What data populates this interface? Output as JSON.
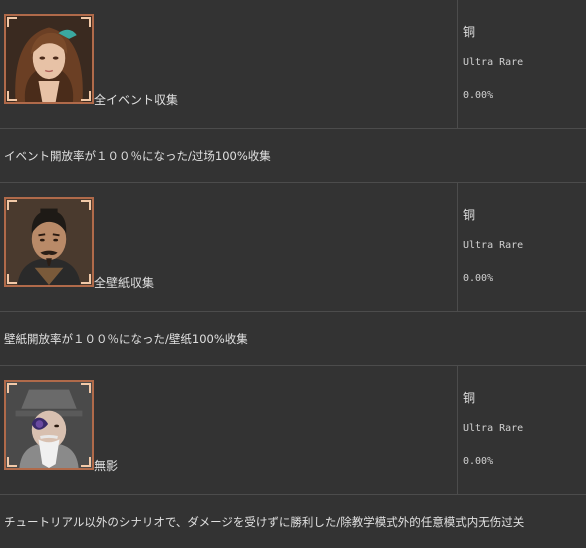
{
  "trophies": [
    {
      "name": "全イベント収集",
      "grade": "铜",
      "rarity": "Ultra Rare",
      "percent": "0.00%",
      "description": "イベント開放率が１００％になった/过场100%收集",
      "icon": "woman-portrait-icon"
    },
    {
      "name": "全壁紙収集",
      "grade": "铜",
      "rarity": "Ultra Rare",
      "percent": "0.00%",
      "description": "壁紙開放率が１００％になった/壁纸100%收集",
      "icon": "man-portrait-icon"
    },
    {
      "name": "無影",
      "grade": "铜",
      "rarity": "Ultra Rare",
      "percent": "0.00%",
      "description": "チュートリアル以外のシナリオで、ダメージを受けずに勝利した/除教学模式外的任意模式内无伤过关",
      "icon": "old-man-portrait-icon"
    }
  ]
}
